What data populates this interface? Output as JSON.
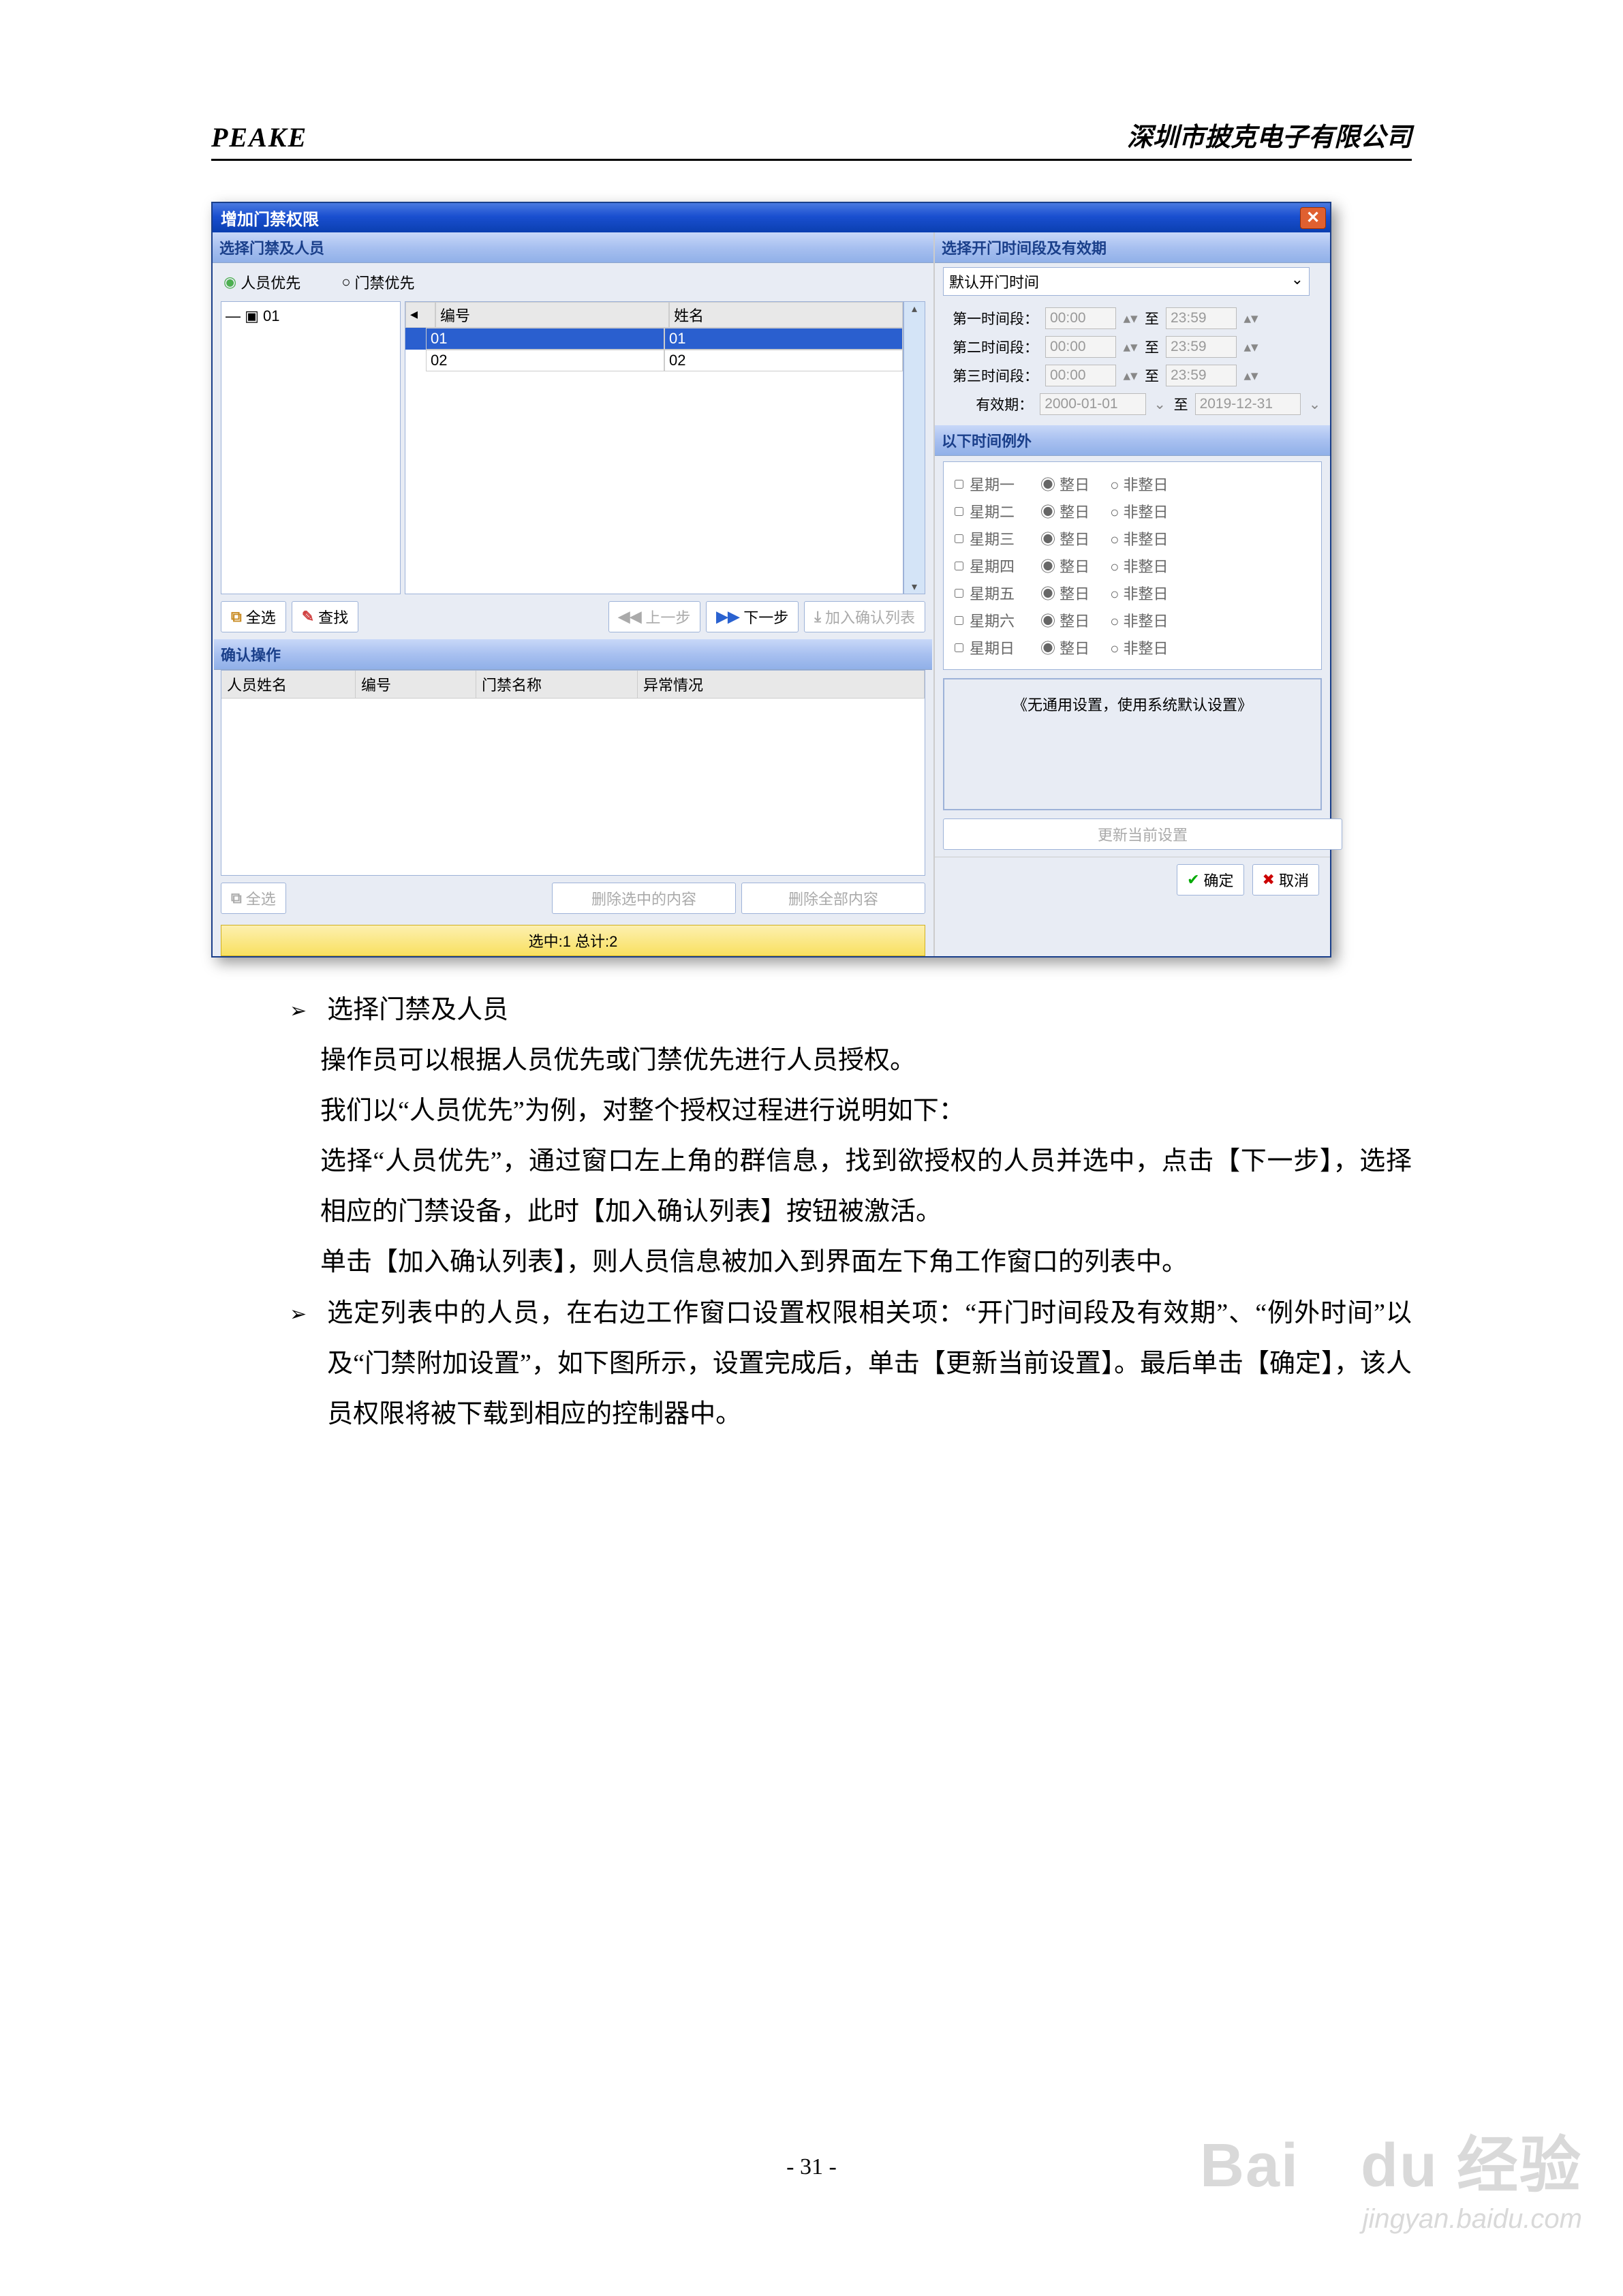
{
  "header": {
    "brand": "PEAKE",
    "company": "深圳市披克电子有限公司"
  },
  "dialog": {
    "title": "增加门禁权限",
    "left_section": "选择门禁及人员",
    "right_section": "选择开门时间段及有效期",
    "radio_person": "人员优先",
    "radio_gate": "门禁优先",
    "tree_root": "01",
    "grid_headers": {
      "id": "编号",
      "name": "姓名"
    },
    "grid_rows": [
      {
        "id": "01",
        "name": "01"
      },
      {
        "id": "02",
        "name": "02"
      }
    ],
    "btns": {
      "select_all": "全选",
      "search": "查找",
      "prev": "上一步",
      "next": "下一步",
      "add_confirm": "加入确认列表",
      "del_sel": "删除选中的内容",
      "del_all": "删除全部内容",
      "update": "更新当前设置",
      "ok": "确定",
      "cancel": "取消"
    },
    "confirm_section": "确认操作",
    "confirm_headers": {
      "name": "人员姓名",
      "id": "编号",
      "gate": "门禁名称",
      "abn": "异常情况"
    },
    "time": {
      "default_combo": "默认开门时间",
      "slot1": "第一时间段：",
      "slot2": "第二时间段：",
      "slot3": "第三时间段：",
      "from": "00:00",
      "to_lbl": "至",
      "to": "23:59",
      "valid_lbl": "有效期：",
      "valid_from": "2000-01-01",
      "valid_to": "2019-12-31"
    },
    "exception_section": "以下时间例外",
    "days": [
      "星期一",
      "星期二",
      "星期三",
      "星期四",
      "星期五",
      "星期六",
      "星期日"
    ],
    "day_opts": {
      "full": "整日",
      "partial": "非整日"
    },
    "general_note": "《无通用设置，使用系统默认设置》",
    "status": "选中:1 总计:2"
  },
  "body": {
    "b1": "选择门禁及人员",
    "l1": "操作员可以根据人员优先或门禁优先进行人员授权。",
    "l2": "我们以“人员优先”为例，对整个授权过程进行说明如下：",
    "l3": "选择“人员优先”，通过窗口左上角的群信息，找到欲授权的人员并选中，点击【下一步】，选择相应的门禁设备，此时【加入确认列表】按钮被激活。",
    "l4": "单击【加入确认列表】，则人员信息被加入到界面左下角工作窗口的列表中。",
    "b2": "选定列表中的人员，在右边工作窗口设置权限相关项：“开门时间段及有效期”、“例外时间”以及“门禁附加设置”，如下图所示，设置完成后，单击【更新当前设置】。最后单击【确定】，该人员权限将被下载到相应的控制器中。"
  },
  "footer": {
    "page": "- 31 -"
  },
  "watermark": {
    "big": "Bai",
    "big2": "du",
    "cn": "经验",
    "url": "jingyan.baidu.com"
  }
}
